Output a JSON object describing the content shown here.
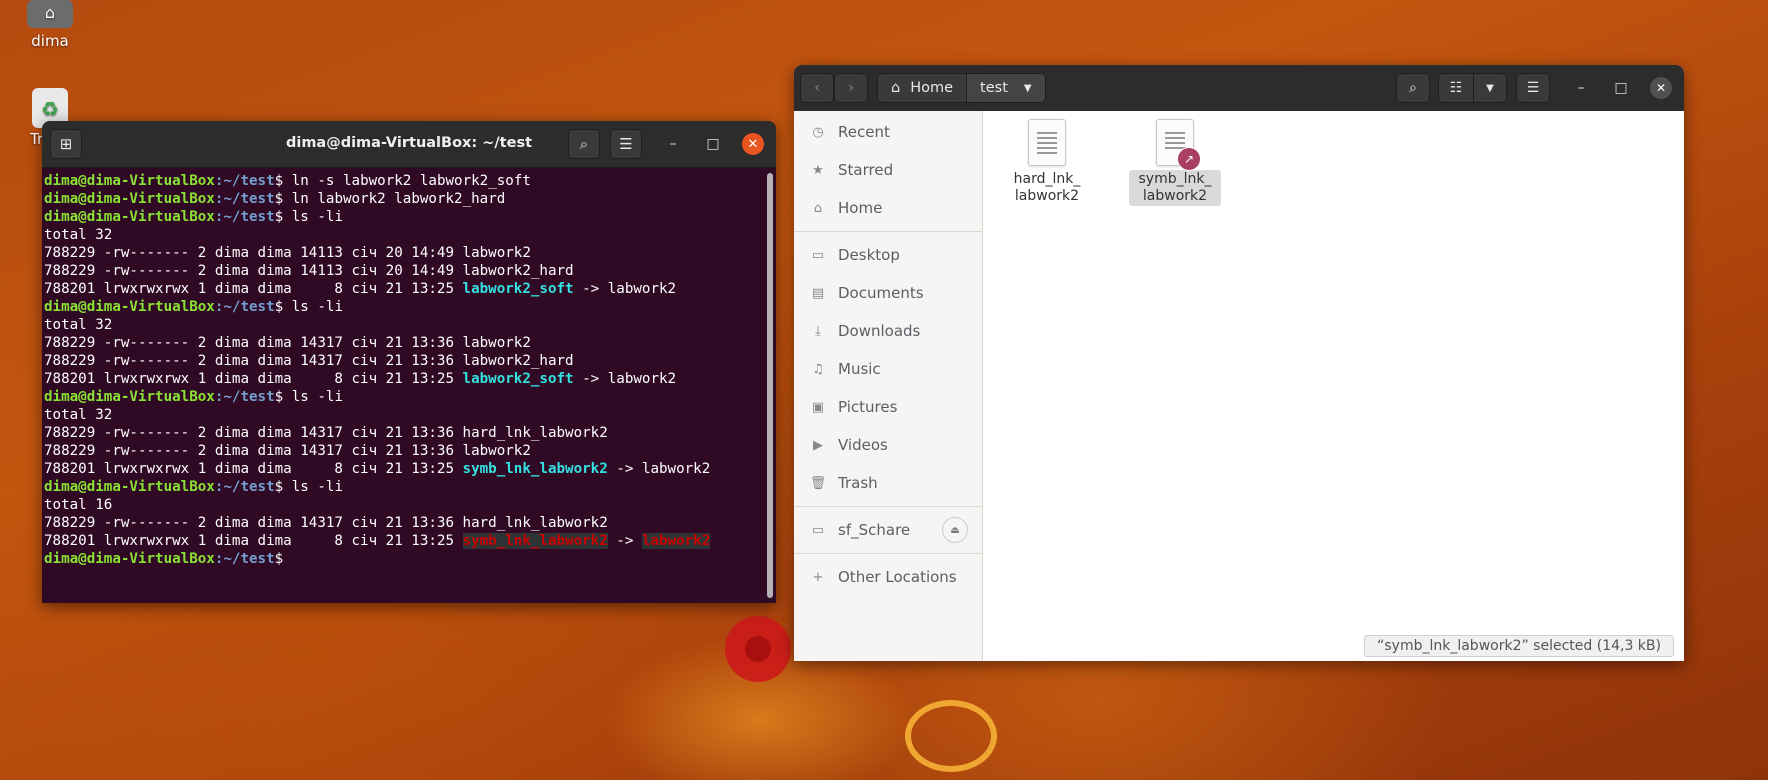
{
  "desktop": {
    "home_icon_label": "dima",
    "trash_icon_label": "Tr"
  },
  "terminal": {
    "title": "dima@dima-VirtualBox: ~/test",
    "prompt_user": "dima@dima-VirtualBox",
    "prompt_path": ":~/test",
    "lines": [
      {
        "kind": "cmd",
        "cmd": "ln -s labwork2 labwork2_soft"
      },
      {
        "kind": "cmd",
        "cmd": "ln labwork2 labwork2_hard"
      },
      {
        "kind": "cmd",
        "cmd": "ls -li"
      },
      {
        "kind": "out",
        "text": "total 32"
      },
      {
        "kind": "out",
        "text": "788229 -rw------- 2 dima dima 14113 січ 20 14:49 labwork2"
      },
      {
        "kind": "out",
        "text": "788229 -rw------- 2 dima dima 14113 січ 20 14:49 labwork2_hard"
      },
      {
        "kind": "link",
        "pre": "788201 lrwxrwxrwx 1 dima dima     8 січ 21 13:25 ",
        "name": "labwork2_soft",
        "arrow": " -> ",
        "target": "labwork2",
        "broken": false
      },
      {
        "kind": "cmd",
        "cmd": "ls -li"
      },
      {
        "kind": "out",
        "text": "total 32"
      },
      {
        "kind": "out",
        "text": "788229 -rw------- 2 dima dima 14317 січ 21 13:36 labwork2"
      },
      {
        "kind": "out",
        "text": "788229 -rw------- 2 dima dima 14317 січ 21 13:36 labwork2_hard"
      },
      {
        "kind": "link",
        "pre": "788201 lrwxrwxrwx 1 dima dima     8 січ 21 13:25 ",
        "name": "labwork2_soft",
        "arrow": " -> ",
        "target": "labwork2",
        "broken": false
      },
      {
        "kind": "cmd",
        "cmd": "ls -li"
      },
      {
        "kind": "out",
        "text": "total 32"
      },
      {
        "kind": "out",
        "text": "788229 -rw------- 2 dima dima 14317 січ 21 13:36 hard_lnk_labwork2"
      },
      {
        "kind": "out",
        "text": "788229 -rw------- 2 dima dima 14317 січ 21 13:36 labwork2"
      },
      {
        "kind": "link",
        "pre": "788201 lrwxrwxrwx 1 dima dima     8 січ 21 13:25 ",
        "name": "symb_lnk_labwork2",
        "arrow": " -> ",
        "target": "labwork2",
        "broken": false
      },
      {
        "kind": "cmd",
        "cmd": "ls -li"
      },
      {
        "kind": "out",
        "text": "total 16"
      },
      {
        "kind": "out",
        "text": "788229 -rw------- 2 dima dima 14317 січ 21 13:36 hard_lnk_labwork2"
      },
      {
        "kind": "link",
        "pre": "788201 lrwxrwxrwx 1 dima dima     8 січ 21 13:25 ",
        "name": "symb_lnk_labwork2",
        "arrow": " -> ",
        "target": "labwork2",
        "broken": true
      },
      {
        "kind": "cmd",
        "cmd": ""
      }
    ]
  },
  "files": {
    "path": [
      "Home",
      "test"
    ],
    "sidebar": [
      {
        "icon": "clock-icon",
        "glyph": "◷",
        "label": "Recent"
      },
      {
        "icon": "star-icon",
        "glyph": "★",
        "label": "Starred"
      },
      {
        "icon": "home-icon",
        "glyph": "⌂",
        "label": "Home"
      },
      {
        "icon": "folder-icon",
        "glyph": "▭",
        "label": "Desktop"
      },
      {
        "icon": "document-icon",
        "glyph": "▤",
        "label": "Documents"
      },
      {
        "icon": "download-icon",
        "glyph": "⤓",
        "label": "Downloads"
      },
      {
        "icon": "music-icon",
        "glyph": "♫",
        "label": "Music"
      },
      {
        "icon": "picture-icon",
        "glyph": "▣",
        "label": "Pictures"
      },
      {
        "icon": "video-icon",
        "glyph": "▶",
        "label": "Videos"
      },
      {
        "icon": "trash-icon",
        "glyph": "🗑",
        "label": "Trash"
      }
    ],
    "mount": {
      "icon": "drive-icon",
      "glyph": "▭",
      "label": "sf_Schare"
    },
    "other": {
      "icon": "plus-icon",
      "glyph": "+",
      "label": "Other Locations"
    },
    "items": [
      {
        "line1": "hard_lnk_",
        "line2": "labwork2",
        "symlink": false,
        "selected": false
      },
      {
        "line1": "symb_lnk_",
        "line2": "labwork2",
        "symlink": true,
        "selected": true
      }
    ],
    "status": "“symb_lnk_labwork2” selected  (14,3 kB)"
  }
}
